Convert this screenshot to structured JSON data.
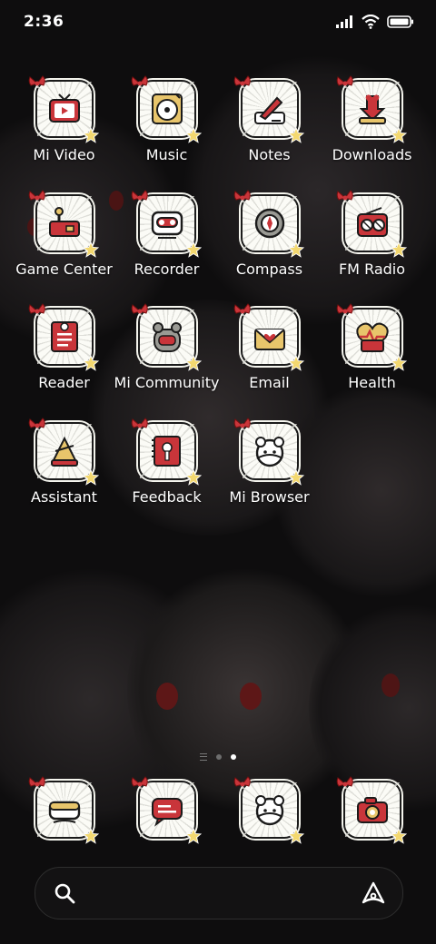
{
  "status_bar": {
    "time": "2:36",
    "icons": [
      "signal-icon",
      "wifi-icon",
      "battery-icon"
    ]
  },
  "apps": [
    {
      "label": "Mi Video",
      "icon": "video-icon"
    },
    {
      "label": "Music",
      "icon": "music-icon"
    },
    {
      "label": "Notes",
      "icon": "notes-icon"
    },
    {
      "label": "Downloads",
      "icon": "downloads-icon"
    },
    {
      "label": "Game Center",
      "icon": "game-center-icon"
    },
    {
      "label": "Recorder",
      "icon": "recorder-icon"
    },
    {
      "label": "Compass",
      "icon": "compass-icon"
    },
    {
      "label": "FM Radio",
      "icon": "radio-icon"
    },
    {
      "label": "Reader",
      "icon": "reader-icon"
    },
    {
      "label": "Mi Community",
      "icon": "community-icon"
    },
    {
      "label": "Email",
      "icon": "email-icon"
    },
    {
      "label": "Health",
      "icon": "health-icon"
    },
    {
      "label": "Assistant",
      "icon": "assistant-icon"
    },
    {
      "label": "Feedback",
      "icon": "feedback-icon"
    },
    {
      "label": "Mi Browser",
      "icon": "browser-icon"
    }
  ],
  "dock": [
    {
      "icon": "phone-icon"
    },
    {
      "icon": "messages-icon"
    },
    {
      "icon": "browser-icon"
    },
    {
      "icon": "camera-icon"
    }
  ],
  "pages": {
    "count": 2,
    "active": 1
  },
  "colors": {
    "accent": "#c9353a",
    "tile_bg": "#fbfbf6",
    "background": "#0e0d0e"
  }
}
